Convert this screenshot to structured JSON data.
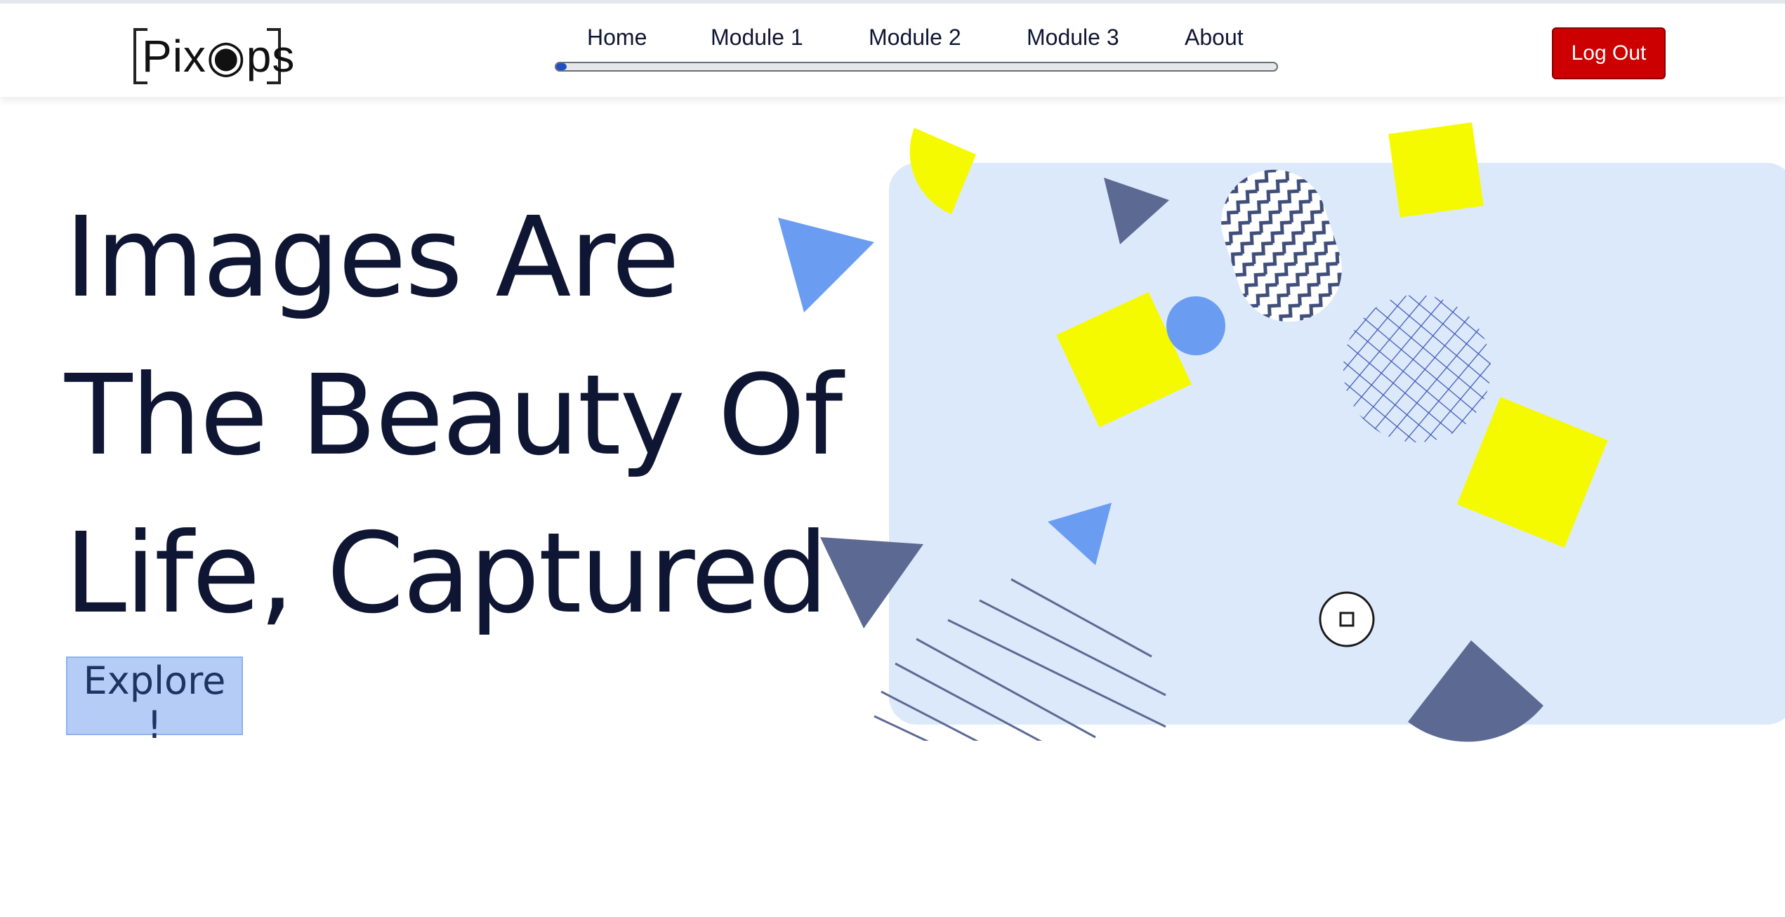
{
  "nav": {
    "logo_text": "Pix◉ps",
    "links": [
      {
        "label": "Home"
      },
      {
        "label": "Module 1"
      },
      {
        "label": "Module 2"
      },
      {
        "label": "Module 3"
      },
      {
        "label": "About"
      }
    ],
    "progress": 0.015,
    "logout_label": "Log Out"
  },
  "hero": {
    "title_lines": [
      "Images Are",
      "The Beauty Of",
      "Life, Captured"
    ],
    "cta_label": "Explore !"
  },
  "colors": {
    "logout_bg": "#cc0000",
    "explore_bg": "#b5cdf6",
    "panel_bg": "#dce9fb",
    "yellow": "#f5fa00",
    "mid_blue": "#6a9df2",
    "slate": "#5c6a93"
  },
  "icons": [
    "aperture-icon",
    "record-stop-icon"
  ]
}
